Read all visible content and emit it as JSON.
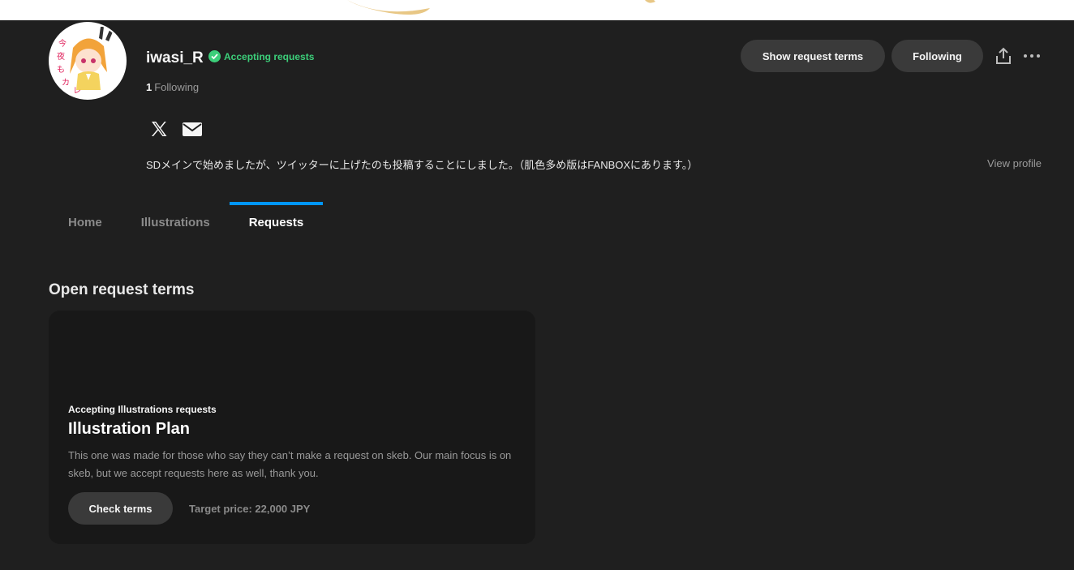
{
  "profile": {
    "username": "iwasi_R",
    "accepting_label": "Accepting requests",
    "following_count": "1",
    "following_label": "Following",
    "bio": "SDメインで始めましたが、ツイッターに上げたのも投稿することにしました。（肌色多め版はFANBOXにあります。）",
    "view_profile_label": "View profile",
    "social_icons": [
      "x-icon",
      "mail-icon"
    ]
  },
  "actions": {
    "show_request_terms_label": "Show request terms",
    "following_button_label": "Following"
  },
  "tabs": [
    {
      "label": "Home",
      "active": false
    },
    {
      "label": "Illustrations",
      "active": false
    },
    {
      "label": "Requests",
      "active": true
    }
  ],
  "requests_section": {
    "title": "Open request terms",
    "card": {
      "kicker": "Accepting Illustrations requests",
      "title": "Illustration Plan",
      "description": "This one was made for those who say they can’t make a request on skeb. Our main focus is on skeb, but we accept requests here as well, thank you.",
      "check_terms_label": "Check terms",
      "target_price": "Target price: 22,000 JPY"
    }
  },
  "colors": {
    "background": "#1f1f1f",
    "accent_blue": "#0096fa",
    "accepting_green": "#3ccf7a",
    "card_bg": "#181818",
    "pill_bg": "#3a3a3a"
  }
}
